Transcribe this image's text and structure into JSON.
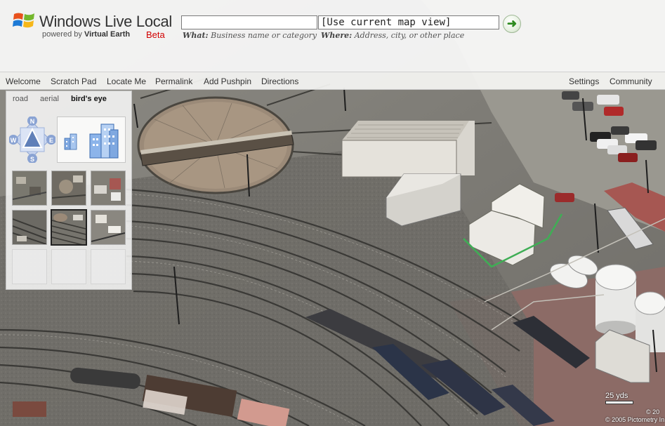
{
  "header": {
    "logo_title": "Windows Live Local",
    "logo_powered_prefix": "powered by",
    "logo_powered_name": "Virtual Earth",
    "logo_beta": "Beta",
    "what_value": "",
    "where_value": "[Use current map view]",
    "what_hint_label": "What:",
    "what_hint_text": "Business name or category",
    "where_hint_label": "Where:",
    "where_hint_text": "Address, city, or other place",
    "go_icon": "green-arrow-icon"
  },
  "menu": {
    "left": [
      "Welcome",
      "Scratch Pad",
      "Locate Me",
      "Permalink",
      "Add Pushpin",
      "Directions"
    ],
    "right": [
      "Settings",
      "Community"
    ]
  },
  "panel": {
    "tabs": [
      "road",
      "aerial",
      "bird's eye"
    ],
    "active_tab": "bird's eye",
    "compass_labels": {
      "n": "N",
      "e": "E",
      "s": "S",
      "w": "W"
    },
    "thumbnails_selected_index": 4,
    "thumbnails_filled": 6,
    "thumbnails_total": 9
  },
  "map": {
    "scale_label": "25 yds",
    "copyright_1": "© 20",
    "copyright_2": "© 2005 Pictometry In"
  },
  "colors": {
    "go_arrow": "#2e8b1f",
    "beta": "#d10000",
    "compass_blue": "#5f7fb8"
  }
}
